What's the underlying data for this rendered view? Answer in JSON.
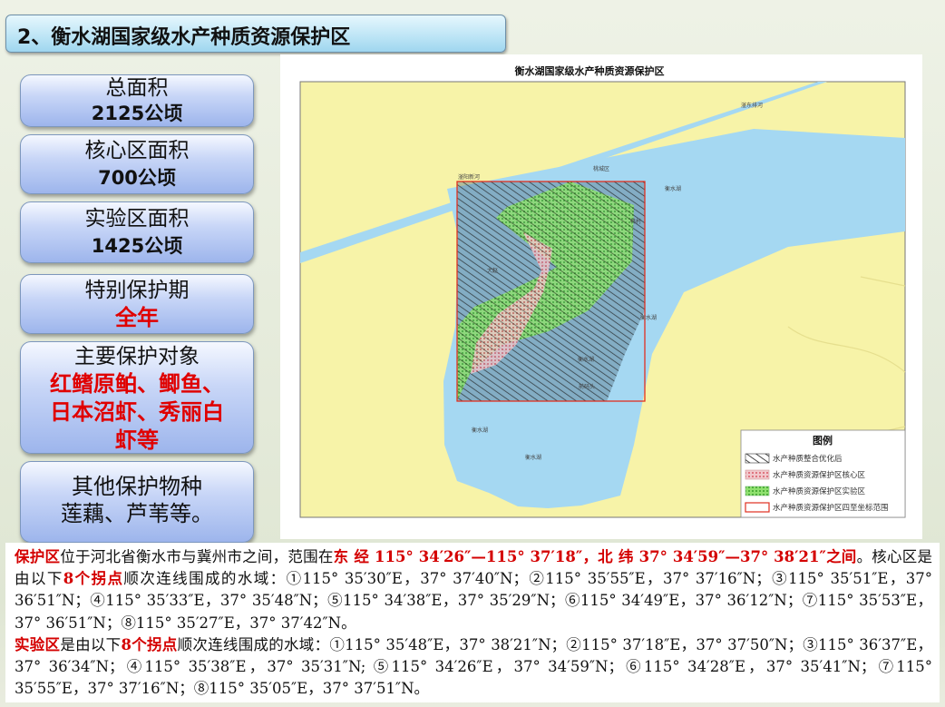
{
  "title": "2、衡水湖国家级水产种质资源保护区",
  "info_boxes": [
    {
      "label": "总面积",
      "value": "2125公顷"
    },
    {
      "label": "核心区面积",
      "value": "700公顷"
    },
    {
      "label": "实验区面积",
      "value": "1425公顷"
    },
    {
      "label": "特别保护期",
      "value": "全年"
    },
    {
      "label": "主要保护对象",
      "lines": [
        "红鳍原鲌、鲫鱼、",
        "日本沼虾、秀丽白",
        "虾等"
      ]
    },
    {
      "label": "其他保护物种",
      "value": "莲藕、芦苇等。"
    }
  ],
  "map": {
    "title": "衡水湖国家级水产种质资源保护区",
    "place_labels": [
      "滏东排河",
      "桃城区",
      "衡水湖",
      "滏阳新河",
      "大赵",
      "衡水湖",
      "衡水湖",
      "前码头",
      "韩村",
      "衡水湖",
      "衡水湖"
    ],
    "legend": {
      "title": "图例",
      "items": [
        {
          "label": "水产种质整合优化后",
          "pattern": "black-hatch"
        },
        {
          "label": "水产种质资源保护区核心区",
          "pattern": "red-dots"
        },
        {
          "label": "水产种质资源保护区实验区",
          "pattern": "green-dots"
        },
        {
          "label": "水产种质资源保护区四至坐标范围",
          "pattern": "red-outline"
        }
      ]
    },
    "colors": {
      "land": "#f7f3a8",
      "water": "#a5d8f2",
      "core": "#c7797f",
      "exp": "#49b935",
      "hatch": "#1a1a1a",
      "bound": "#e03020"
    }
  },
  "description": {
    "p1": {
      "r1": "保护区",
      "t1": "位于河北省衡水市与冀州市之间，范围在",
      "r2": "东 经 115° 34′26″—115° 37′18″，北 纬 37° 34′59″—37° 38′21″之间",
      "t2": "。核心区是由以下",
      "r3": "8个拐点",
      "t3": "顺次连线围成的水域：①115° 35′30″E，37° 37′40″N；②115° 35′55″E，37° 37′16″N；③115° 35′51″E，37° 36′51″N；④115° 35′33″E，37° 35′48″N；⑤115° 34′38″E，37° 35′29″N；⑥115° 34′49″E，37° 36′12″N；⑦115° 35′53″E，37° 36′51″N；⑧115° 35′27″E，37° 37′42″N。"
    },
    "p2": {
      "r1": "实验区",
      "t1": "是由以下",
      "r2": "8个拐点",
      "t2": "顺次连线围成的水域：①115° 35′48″E，37° 38′21″N；②115° 37′18″E，37° 37′50″N；③115° 36′37″E，37° 36′34″N；④115° 35′38″E，37° 35′31″N; ⑤115° 34′26″E，37° 34′59″N；⑥115° 34′28″E，37° 35′41″N；⑦115° 35′55″E，37° 37′16″N；⑧115° 35′05″E，37° 37′51″N。"
    }
  }
}
